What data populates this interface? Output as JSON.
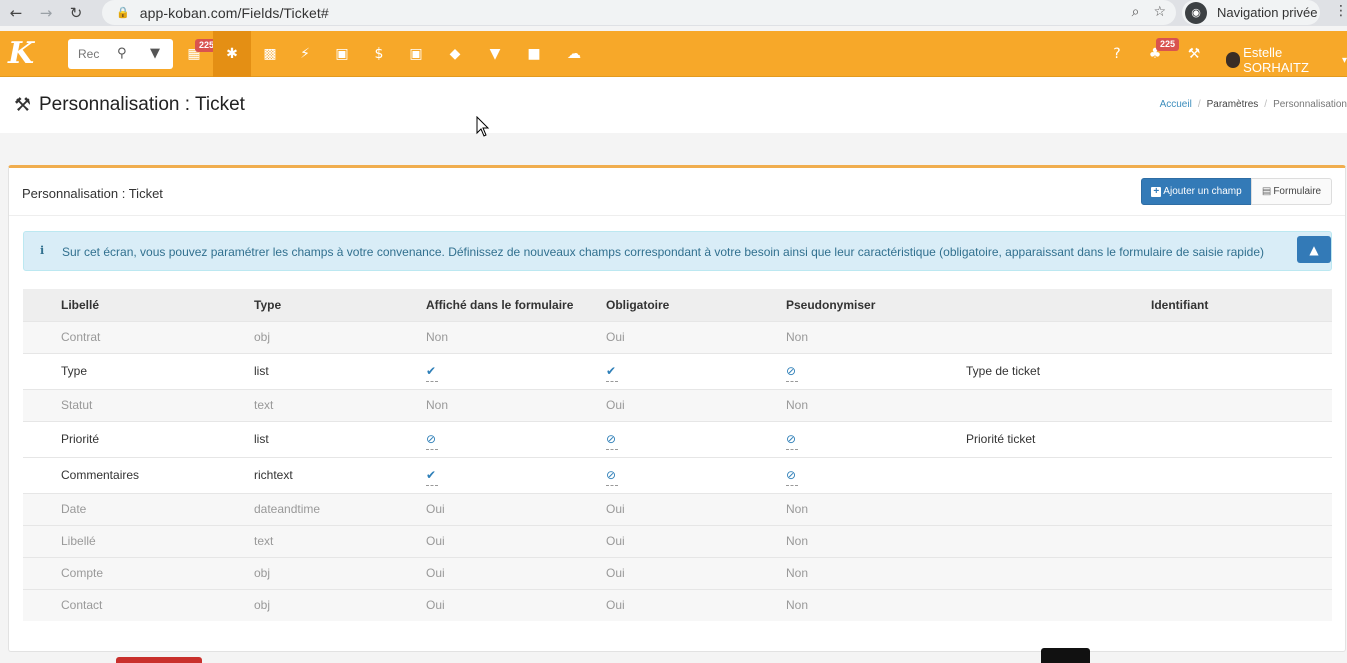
{
  "browser": {
    "url": "app-koban.com/Fields/Ticket#",
    "incognito_label": "Navigation privée",
    "icons": [
      "back-icon",
      "forward-icon",
      "reload-icon",
      "lock-icon",
      "zoom-icon",
      "star-icon",
      "incognito-icon",
      "kebab-icon"
    ]
  },
  "navbar": {
    "search_placeholder": "Rec",
    "calendar_badge": "225",
    "notif_badge": "225",
    "user_name": "Estelle SORHAITZ",
    "colors": {
      "bar": "#f7a829",
      "active": "#e48f14",
      "badge": "#d9534f"
    },
    "icons": [
      "calendar-icon",
      "asterisk-icon",
      "building-icon",
      "bolt-icon",
      "money-icon",
      "dollar-icon",
      "briefcase-icon",
      "tag-icon",
      "megaphone-icon",
      "puzzle-icon",
      "cloud-icon",
      "help-icon",
      "bell-icon",
      "wrench-icon"
    ]
  },
  "page": {
    "title": "Personnalisation : Ticket",
    "breadcrumb": [
      "Accueil",
      "Paramètres",
      "Personnalisation"
    ]
  },
  "box": {
    "title": "Personnalisation : Ticket",
    "add_button": "Ajouter un champ",
    "form_button": "Formulaire",
    "info_text": "Sur cet écran, vous pouvez paramétrer les champs à votre convenance. Définissez de nouveaux champs correspondant à votre besoin ainsi que leur caractéristique (obligatoire, apparaissant dans le formulaire de saisie rapide)"
  },
  "table": {
    "headers": [
      "Libellé",
      "Type",
      "Affiché dans le formulaire",
      "Obligatoire",
      "Pseudonymiser",
      "",
      "Identifiant"
    ],
    "rows": [
      {
        "label": "Contrat",
        "type": "obj",
        "form": "Non",
        "required": "Oui",
        "pseudo": "Non",
        "name": "",
        "id": ""
      },
      {
        "label": "Type",
        "type": "list",
        "form": "check-icon",
        "required": "check-icon",
        "pseudo": "ban-icon",
        "name": "Type de ticket",
        "id": ""
      },
      {
        "label": "Statut",
        "type": "text",
        "form": "Non",
        "required": "Oui",
        "pseudo": "Non",
        "name": "",
        "id": ""
      },
      {
        "label": "Priorité",
        "type": "list",
        "form": "ban-icon",
        "required": "ban-icon",
        "pseudo": "ban-icon",
        "name": "Priorité ticket",
        "id": ""
      },
      {
        "label": "Commentaires",
        "type": "richtext",
        "form": "check-icon",
        "required": "ban-icon",
        "pseudo": "ban-icon",
        "name": "",
        "id": ""
      },
      {
        "label": "Date",
        "type": "dateandtime",
        "form": "Oui",
        "required": "Oui",
        "pseudo": "Non",
        "name": "",
        "id": ""
      },
      {
        "label": "Libellé",
        "type": "text",
        "form": "Oui",
        "required": "Oui",
        "pseudo": "Non",
        "name": "",
        "id": ""
      },
      {
        "label": "Compte",
        "type": "obj",
        "form": "Oui",
        "required": "Oui",
        "pseudo": "Non",
        "name": "",
        "id": ""
      },
      {
        "label": "Contact",
        "type": "obj",
        "form": "Oui",
        "required": "Oui",
        "pseudo": "Non",
        "name": "",
        "id": ""
      }
    ]
  }
}
